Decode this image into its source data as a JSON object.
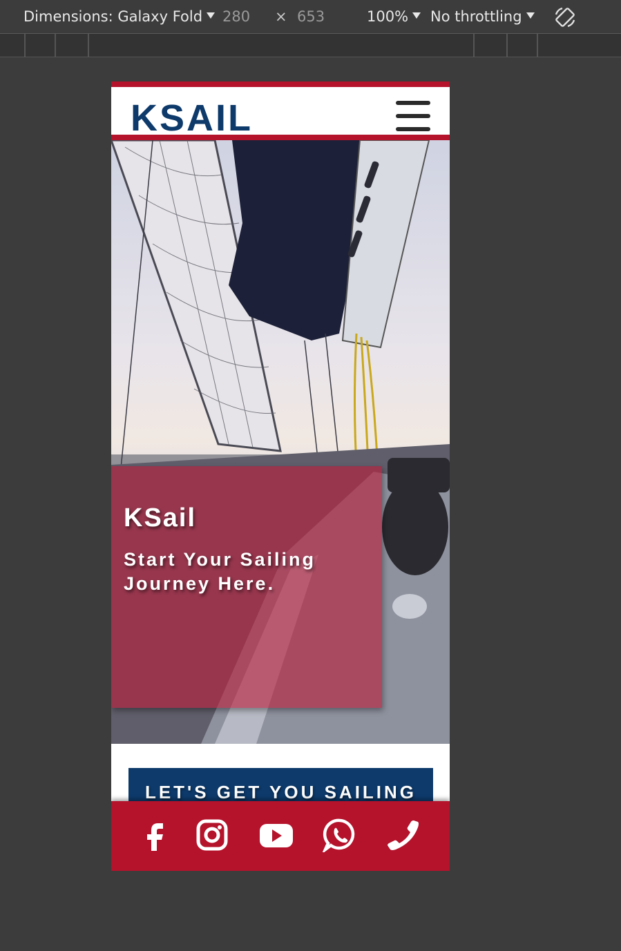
{
  "devtools": {
    "dimensions_label": "Dimensions: Galaxy Fold",
    "width": "280",
    "times": "×",
    "height": "653",
    "zoom": "100%",
    "throttling": "No throttling"
  },
  "site": {
    "logo": "KSAIL",
    "hero_title": "KSail",
    "hero_subtitle": "Start Your Sailing Journey Here.",
    "cta_label": "LET'S GET YOU SAILING",
    "social": [
      "facebook-icon",
      "instagram-icon",
      "youtube-icon",
      "whatsapp-icon",
      "phone-icon"
    ],
    "colors": {
      "brand_red": "#b5122b",
      "brand_navy": "#0d3a6b"
    }
  }
}
